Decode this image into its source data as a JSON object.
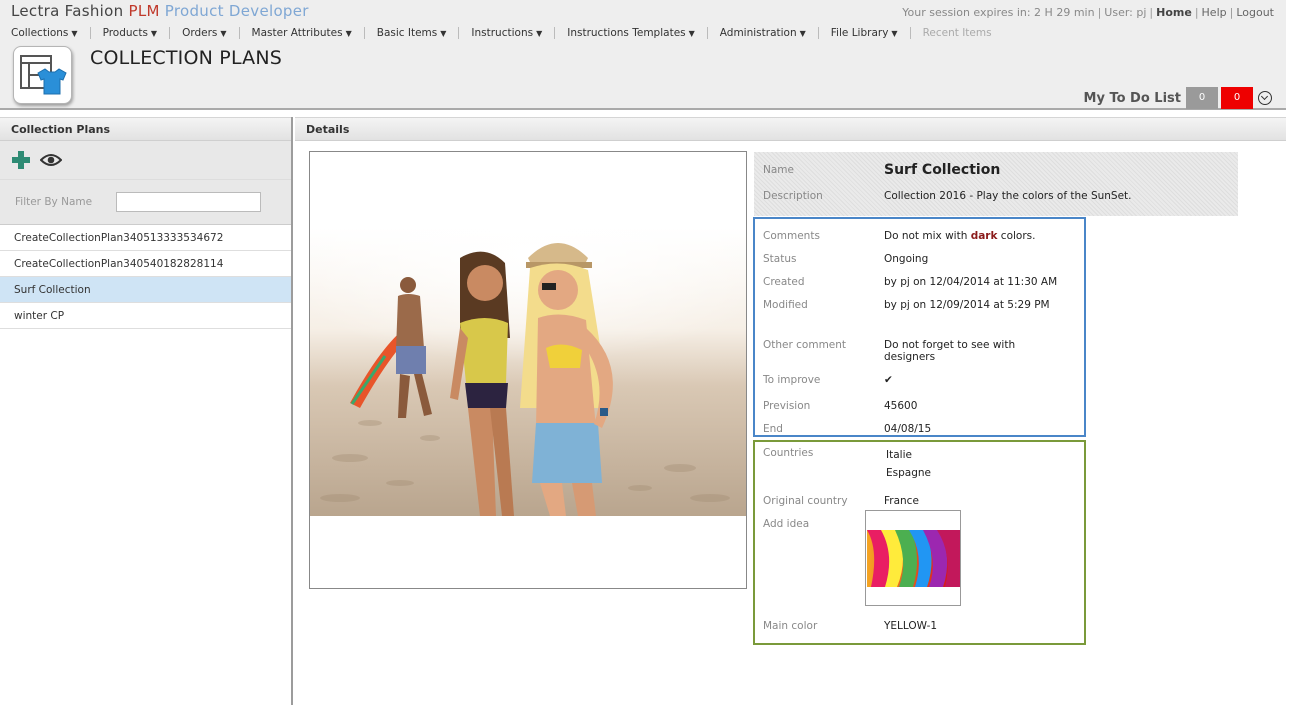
{
  "brand": {
    "part1": "Lectra Fashion ",
    "part2": "PLM",
    "part3": " Product Developer"
  },
  "session": {
    "expires": "Your session expires in: 2 H 29 min",
    "user": "User: pj",
    "home": "Home",
    "help": "Help",
    "logout": "Logout",
    "sep": "|"
  },
  "menu": [
    {
      "label": "Collections"
    },
    {
      "label": "Products"
    },
    {
      "label": "Orders"
    },
    {
      "label": "Master Attributes"
    },
    {
      "label": "Basic Items"
    },
    {
      "label": "Instructions"
    },
    {
      "label": "Instructions Templates"
    },
    {
      "label": "Administration"
    },
    {
      "label": "File Library"
    },
    {
      "label": "Recent Items"
    }
  ],
  "page_title": "COLLECTION PLANS",
  "todo": {
    "label": "My To Do List",
    "grey_count": "0",
    "red_count": "0"
  },
  "left": {
    "header": "Collection Plans",
    "filter_label": "Filter By Name",
    "filter_value": "",
    "items": [
      {
        "label": "CreateCollectionPlan340513333534672"
      },
      {
        "label": "CreateCollectionPlan340540182828114"
      },
      {
        "label": "Surf Collection",
        "selected": true
      },
      {
        "label": "winter CP"
      }
    ]
  },
  "details": {
    "header": "Details",
    "name_label": "Name",
    "name_value": "Surf Collection",
    "description_label": "Description",
    "description_value": "Collection 2016 - Play the colors of the SunSet.",
    "comments_label": "Comments",
    "comments_before": "Do not mix with ",
    "comments_bold": "dark",
    "comments_after": " colors.",
    "status_label": "Status",
    "status_value": "Ongoing",
    "created_label": "Created",
    "created_value": "by pj on 12/04/2014 at 11:30 AM",
    "modified_label": "Modified",
    "modified_value": "by pj on 12/09/2014 at 5:29 PM",
    "other_comment_label": "Other comment",
    "other_comment_line1": "Do not forget to see with",
    "other_comment_line2": "designers",
    "to_improve_label": "To improve",
    "to_improve_value": "✔",
    "prevision_label": "Prevision",
    "prevision_value": "45600",
    "end_label": "End",
    "end_value": "04/08/15",
    "countries_label": "Countries",
    "countries": [
      "Italie",
      "Espagne"
    ],
    "original_country_label": "Original country",
    "original_country_value": "France",
    "add_idea_label": "Add idea",
    "main_color_label": "Main color",
    "main_color_value": "YELLOW-1"
  },
  "colors": {
    "accent_blue": "#4a86c8",
    "accent_green": "#7a9a3a",
    "todo_red": "#ee0000",
    "todo_grey": "#9a9a9a",
    "selected_row": "#cfe4f5"
  },
  "icons": {
    "app": "collection-plan-icon",
    "add": "plus-icon",
    "view": "eye-icon",
    "todo_toggle": "chevron-circle-down-icon"
  }
}
